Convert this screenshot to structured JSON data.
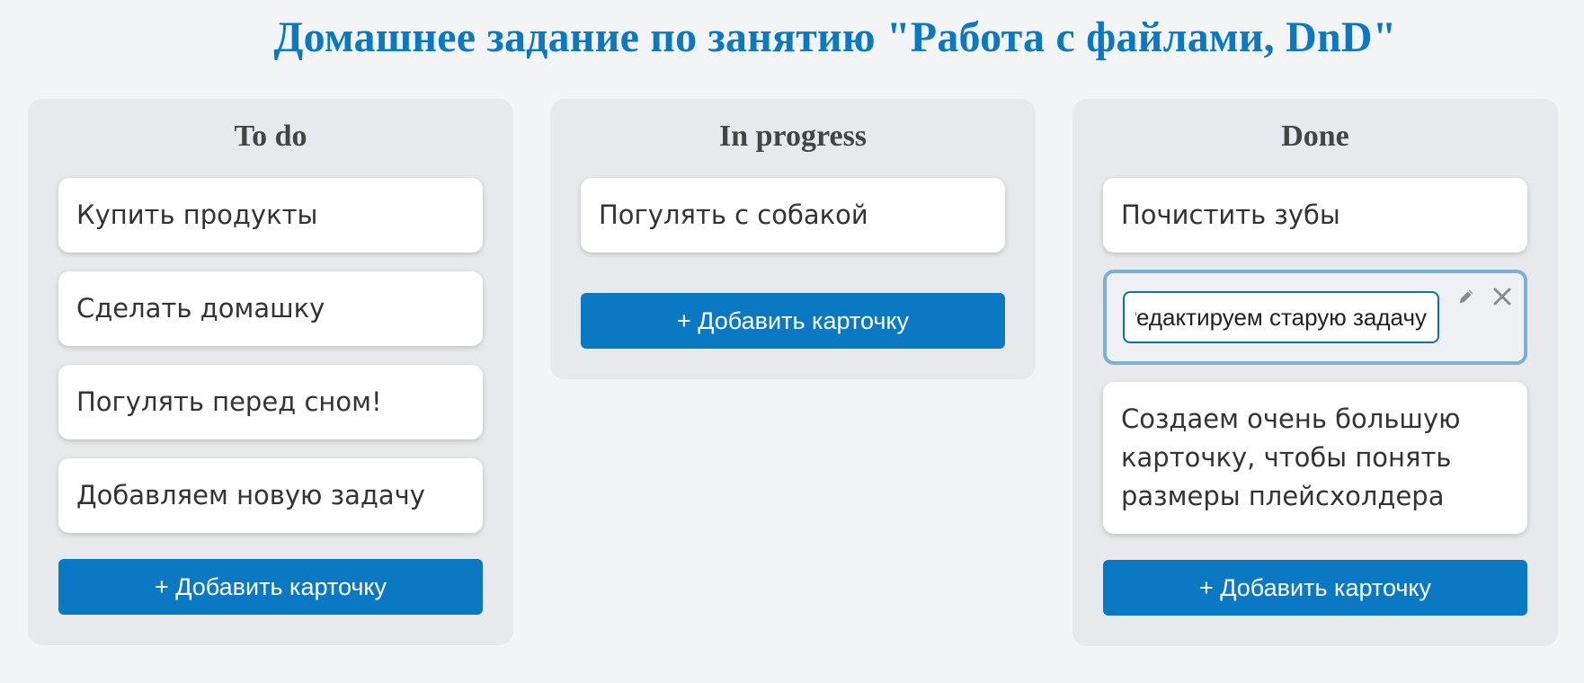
{
  "page": {
    "title": "Домашнее задание по занятию \"Работа с файлами, DnD\""
  },
  "columns": [
    {
      "title": "To do",
      "cards": [
        "Купить продукты",
        "Сделать домашку",
        "Погулять перед сном!",
        "Добавляем новую задачу"
      ],
      "add_label": "+ Добавить карточку"
    },
    {
      "title": "In progress",
      "cards": [
        "Погулять с собакой"
      ],
      "add_label": "+ Добавить карточку"
    },
    {
      "title": "Done",
      "cards": [
        "Почистить зубы",
        "Создаем очень большую карточку, чтобы понять размеры плейсхолдера"
      ],
      "editing_card": {
        "value": "Редактируем старую задачу"
      },
      "add_label": "+ Добавить карточку"
    }
  ],
  "icons": {
    "edit": "pencil-icon",
    "delete": "close-icon"
  },
  "colors": {
    "accent": "#0a78c2",
    "column_bg": "#e8e9ed",
    "page_bg": "#f3f4f6",
    "editing_border": "#7bb0d4"
  }
}
